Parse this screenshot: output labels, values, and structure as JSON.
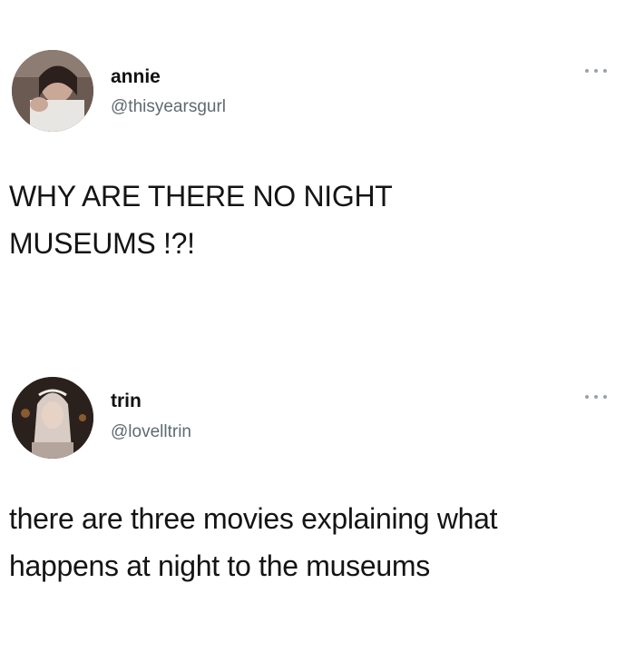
{
  "tweets": [
    {
      "display_name": "annie",
      "handle": "@thisyearsgurl",
      "text": "WHY ARE THERE NO NIGHT\nMUSEUMS !?!",
      "menu_icon": "more-horizontal-icon"
    },
    {
      "display_name": "trin",
      "handle": "@lovelltrin",
      "text": "there are three movies explaining what\nhappens at night to the museums",
      "menu_icon": "more-horizontal-icon"
    }
  ]
}
